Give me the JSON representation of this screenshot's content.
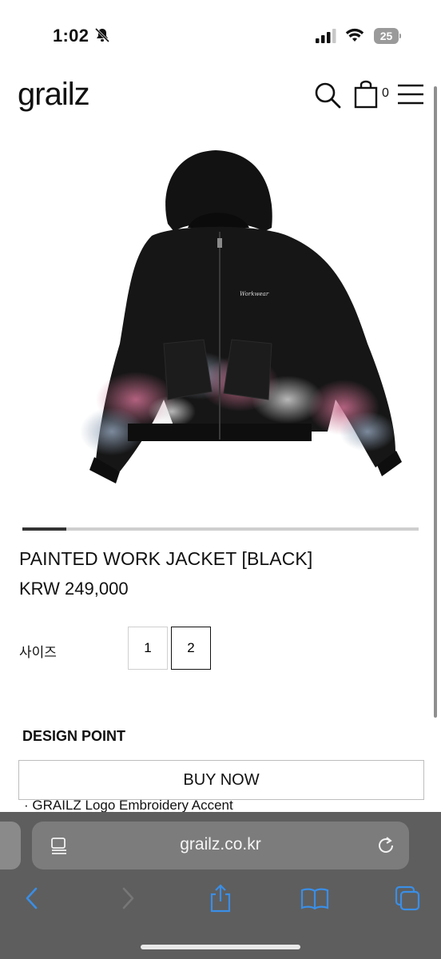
{
  "status_bar": {
    "time": "1:02",
    "battery_level": "25"
  },
  "header": {
    "logo": "grailz",
    "cart_count": "0"
  },
  "gallery": {
    "current_position_fraction": 0.11
  },
  "product": {
    "title": "PAINTED WORK JACKET [BLACK]",
    "price": "KRW 249,000",
    "size_label": "사이즈",
    "sizes": [
      "1",
      "2"
    ],
    "selected_size": "2",
    "design_point_label": "DESIGN POINT",
    "buy_now_label": "BUY NOW",
    "feature_line": "· GRAILZ Logo Embroidery Accent"
  },
  "browser": {
    "url": "grailz.co.kr"
  },
  "colors": {
    "browser_chrome": "#5e5e5e",
    "browser_icon_blue": "#3a8ee6"
  }
}
